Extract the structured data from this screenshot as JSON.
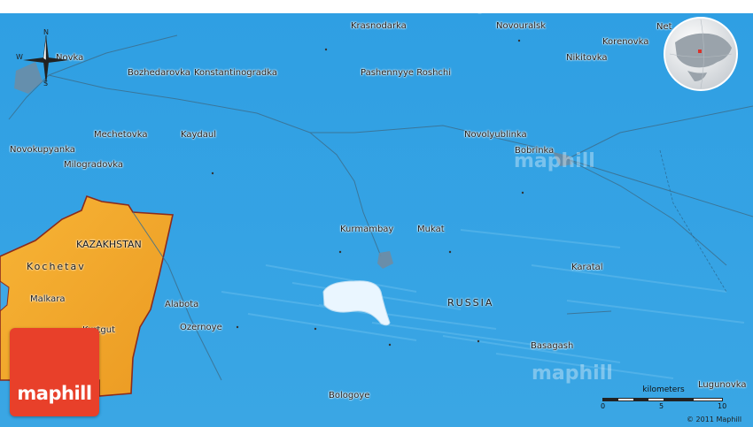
{
  "map": {
    "colors": {
      "water": "#3fa8e6",
      "water_dark": "#2f8fd0",
      "land_highlight": "#f4a92a",
      "land_border": "#8b2b1d",
      "lake": "#eaf6ff",
      "road": "#3c6f8e"
    },
    "cities": [
      {
        "name": "Krasnodarka"
      },
      {
        "name": "Novouralsk"
      },
      {
        "name": "Korenovka"
      },
      {
        "name": "Nikitovka"
      },
      {
        "name": "Bozhedarovka"
      },
      {
        "name": "Konstantinogradka"
      },
      {
        "name": "Pashennyye Roshchi"
      },
      {
        "name": "Mechetovka"
      },
      {
        "name": "Kaydaul"
      },
      {
        "name": "Novolyublinka"
      },
      {
        "name": "Novokupyanka"
      },
      {
        "name": "Bobrinka"
      },
      {
        "name": "Milogradovka"
      },
      {
        "name": "Kurmambay"
      },
      {
        "name": "Mukat"
      },
      {
        "name": "Karatal"
      },
      {
        "name": "Malkara"
      },
      {
        "name": "Alabota"
      },
      {
        "name": "Ozernoye"
      },
      {
        "name": "Basagash"
      },
      {
        "name": "Bologoye"
      },
      {
        "name": "Lugunovka"
      },
      {
        "name": "Novka"
      },
      {
        "name": "Net"
      },
      {
        "name": "Kurtgut"
      }
    ],
    "regions": {
      "kazakhstan_label": "KAZAKHSTAN",
      "kochetav_label": "Kochetav",
      "russia_label": "RUSSIA"
    },
    "compass": {
      "n": "N",
      "s": "S",
      "w": "W"
    },
    "watermark": "maphill"
  },
  "logo": {
    "text": "maphill"
  },
  "scale": {
    "title": "kilometers",
    "ticks": [
      "0",
      "5",
      "10"
    ]
  },
  "copyright": "© 2011 Maphill"
}
